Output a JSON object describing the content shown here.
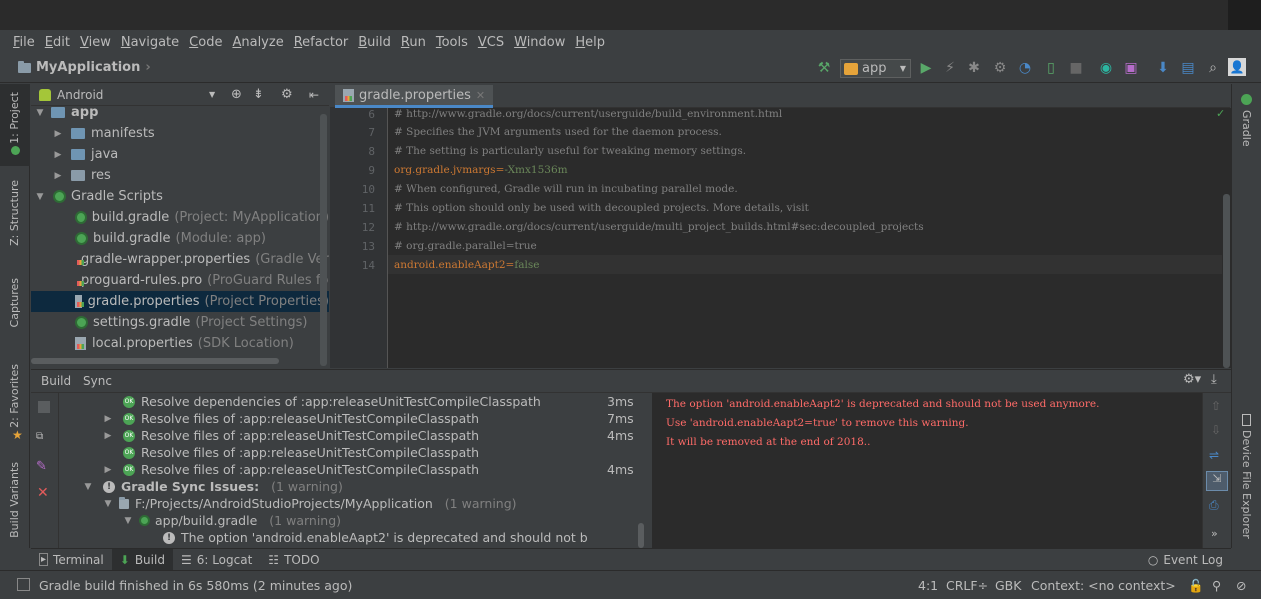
{
  "menu": [
    "File",
    "Edit",
    "View",
    "Navigate",
    "Code",
    "Analyze",
    "Refactor",
    "Build",
    "Run",
    "Tools",
    "VCS",
    "Window",
    "Help"
  ],
  "nav": {
    "project": "MyApplication",
    "run_config": "app"
  },
  "left_tabs": {
    "project": "1: Project",
    "structure": "Z: Structure",
    "captures": "Captures",
    "favorites": "2: Favorites",
    "build_variants": "Build Variants"
  },
  "right_tabs": {
    "gradle": "Gradle",
    "device_explorer": "Device File Explorer"
  },
  "project_panel": {
    "view": "Android",
    "tree": [
      {
        "label": "app",
        "hint": ""
      },
      {
        "label": "manifests",
        "hint": ""
      },
      {
        "label": "java",
        "hint": ""
      },
      {
        "label": "res",
        "hint": ""
      },
      {
        "label": "Gradle Scripts",
        "hint": ""
      },
      {
        "label": "build.gradle",
        "hint": "(Project: MyApplication)"
      },
      {
        "label": "build.gradle",
        "hint": "(Module: app)"
      },
      {
        "label": "gradle-wrapper.properties",
        "hint": "(Gradle Versi"
      },
      {
        "label": "proguard-rules.pro",
        "hint": "(ProGuard Rules for"
      },
      {
        "label": "gradle.properties",
        "hint": "(Project Properties)"
      },
      {
        "label": "settings.gradle",
        "hint": "(Project Settings)"
      },
      {
        "label": "local.properties",
        "hint": "(SDK Location)"
      }
    ]
  },
  "editor": {
    "tab": "gradle.properties",
    "lines": [
      {
        "n": "6",
        "text": "# http://www.gradle.org/docs/current/userguide/build_environment.html"
      },
      {
        "n": "7",
        "text": "# Specifies the JVM arguments used for the daemon process."
      },
      {
        "n": "8",
        "text": "# The setting is particularly useful for tweaking memory settings."
      },
      {
        "n": "9",
        "key": "org.gradle.jvmargs",
        "val": "-Xmx1536m"
      },
      {
        "n": "10",
        "text": "# When configured, Gradle will run in incubating parallel mode."
      },
      {
        "n": "11",
        "text": "# This option should only be used with decoupled projects. More details, visit"
      },
      {
        "n": "12",
        "text": "# http://www.gradle.org/docs/current/userguide/multi_project_builds.html#sec:decoupled_projects"
      },
      {
        "n": "13",
        "text": "# org.gradle.parallel=true"
      },
      {
        "n": "14",
        "key": "android.enableAapt2",
        "val": "false"
      }
    ]
  },
  "build_panel": {
    "tabs": [
      "Build",
      "Sync"
    ],
    "tree": [
      {
        "label": "Resolve dependencies of :app:releaseUnitTestCompileClasspath",
        "time": "3ms"
      },
      {
        "label": "Resolve files of :app:releaseUnitTestCompileClasspath",
        "time": "7ms"
      },
      {
        "label": "Resolve files of :app:releaseUnitTestCompileClasspath",
        "time": "4ms"
      },
      {
        "label": "Resolve files of :app:releaseUnitTestCompileClasspath",
        "time": ""
      },
      {
        "label": "Resolve files of :app:releaseUnitTestCompileClasspath",
        "time": "4ms"
      },
      {
        "label": "Gradle Sync Issues:",
        "hint": "(1 warning)"
      },
      {
        "label": "F:/Projects/AndroidStudioProjects/MyApplication",
        "hint": "(1 warning)"
      },
      {
        "label": "app/build.gradle",
        "hint": "(1 warning)"
      },
      {
        "label": "The option 'android.enableAapt2' is deprecated and should not b",
        "hint": ""
      }
    ],
    "output": [
      "The option 'android.enableAapt2' is deprecated and should not be used anymore.",
      "Use 'android.enableAapt2=true' to remove this warning.",
      "It will be removed at the end of 2018.."
    ]
  },
  "tool_tabs": [
    "Terminal",
    "Build",
    "6: Logcat",
    "TODO",
    "Event Log"
  ],
  "status": {
    "message": "Gradle build finished in 6s 580ms (2 minutes ago)",
    "position": "4:1",
    "line_sep": "CRLF÷",
    "encoding": "GBK",
    "context": "Context: <no context>"
  },
  "colors": {
    "accent": "#4a88c7",
    "error": "#ff6b68",
    "ok": "#4ca455",
    "run": "#59a869"
  }
}
